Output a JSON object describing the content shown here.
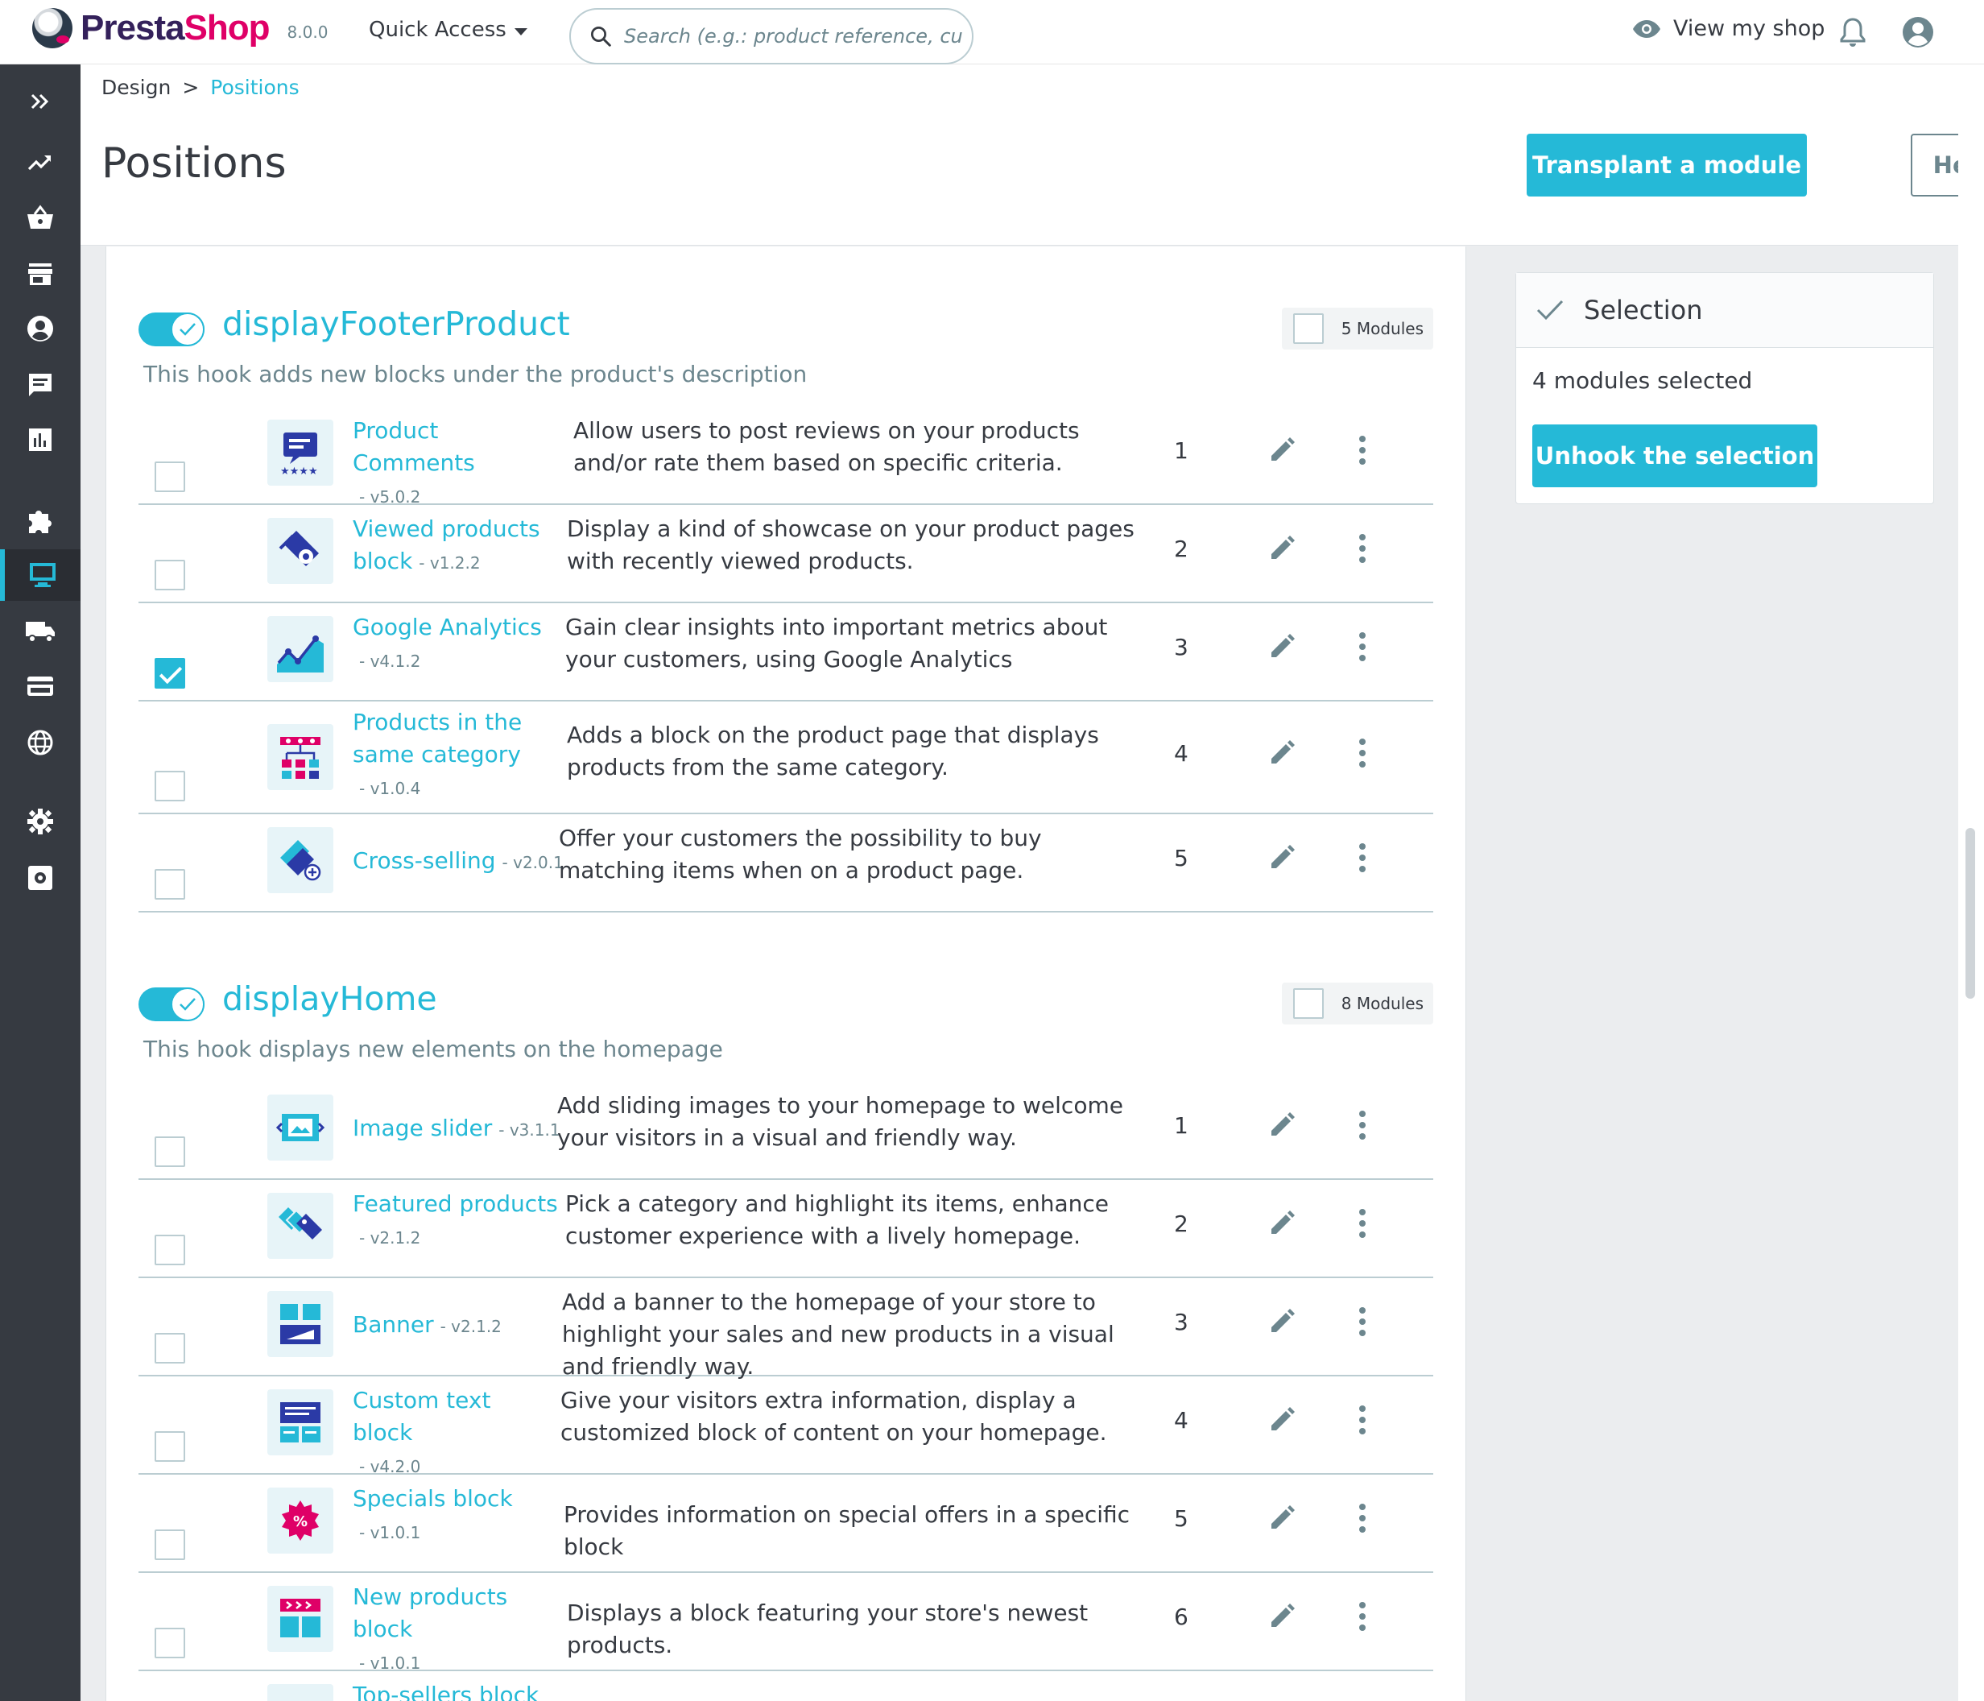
{
  "app": {
    "brand_part1": "Presta",
    "brand_part2": "Shop",
    "version": "8.0.0",
    "quick_access": "Quick Access",
    "search_placeholder": "Search (e.g.: product reference, custon",
    "view_shop": "View my shop"
  },
  "breadcrumb": {
    "parent": "Design",
    "separator": ">",
    "current": "Positions"
  },
  "page": {
    "title": "Positions",
    "transplant_button": "Transplant a module",
    "help_button": "Help"
  },
  "sidebar": {
    "items": [
      "expand-icon",
      "stats-trend-icon",
      "basket-icon",
      "store-icon",
      "customer-icon",
      "message-icon",
      "stats-icon",
      "puzzle-icon",
      "display-icon",
      "truck-icon",
      "card-icon",
      "globe-icon",
      "settings-icon",
      "advanced-settings-icon"
    ],
    "active": "display-icon"
  },
  "selection": {
    "title": "Selection",
    "count_text": "4 modules selected",
    "unhook_button": "Unhook the selection"
  },
  "colors": {
    "accent": "#25b9d7",
    "sidebar": "#363a41",
    "text": "#363a41",
    "muted": "#6c868e"
  },
  "hooks": [
    {
      "name": "displayFooterProduct",
      "description": "This hook adds new blocks under the product's description",
      "modules_count": "5 Modules",
      "modules": [
        {
          "title": "Product Comments",
          "version": "- v5.0.2",
          "description": "Allow users to post reviews on your products and/or rate them based on specific criteria.",
          "position": "1",
          "checked": false,
          "icon": "comments-icon"
        },
        {
          "title": "Viewed products block",
          "version": "- v1.2.2",
          "description": "Display a kind of showcase on your product pages with recently viewed products.",
          "position": "2",
          "checked": false,
          "icon": "viewed-products-icon"
        },
        {
          "title": "Google Analytics",
          "version": "- v4.1.2",
          "description": "Gain clear insights into important metrics about your customers, using Google Analytics",
          "position": "3",
          "checked": true,
          "icon": "analytics-icon"
        },
        {
          "title": "Products in the same category",
          "version": "- v1.0.4",
          "description": "Adds a block on the product page that displays products from the same category.",
          "position": "4",
          "checked": false,
          "icon": "category-products-icon"
        },
        {
          "title": "Cross-selling",
          "version": "- v2.0.1",
          "description": "Offer your customers the possibility to buy matching items when on a product page.",
          "position": "5",
          "checked": false,
          "icon": "cross-selling-icon"
        }
      ]
    },
    {
      "name": "displayHome",
      "description": "This hook displays new elements on the homepage",
      "modules_count": "8 Modules",
      "modules": [
        {
          "title": "Image slider",
          "version": "- v3.1.1",
          "description": "Add sliding images to your homepage to welcome your visitors in a visual and friendly way.",
          "position": "1",
          "checked": false,
          "icon": "image-slider-icon"
        },
        {
          "title": "Featured products",
          "version": "- v2.1.2",
          "description": "Pick a category and highlight its items, enhance customer experience with a lively homepage.",
          "position": "2",
          "checked": false,
          "icon": "featured-products-icon"
        },
        {
          "title": "Banner",
          "version": "- v2.1.2",
          "description": "Add a banner to the homepage of your store to highlight your sales and new products in a visual and friendly way.",
          "position": "3",
          "checked": false,
          "icon": "banner-icon"
        },
        {
          "title": "Custom text block",
          "version": "- v4.2.0",
          "description": "Give your visitors extra information, display a customized block of content on your homepage.",
          "position": "4",
          "checked": false,
          "icon": "custom-text-icon"
        },
        {
          "title": "Specials block",
          "version": "- v1.0.1",
          "description": "Provides information on special offers in a specific block",
          "position": "5",
          "checked": false,
          "icon": "specials-icon"
        },
        {
          "title": "New products block",
          "version": "- v1.0.1",
          "description": "Displays a block featuring your store's newest products.",
          "position": "6",
          "checked": false,
          "icon": "new-products-icon"
        },
        {
          "title": "Top-sellers block",
          "version": "",
          "description": "",
          "position": "",
          "checked": false,
          "icon": "top-sellers-icon"
        }
      ]
    }
  ]
}
